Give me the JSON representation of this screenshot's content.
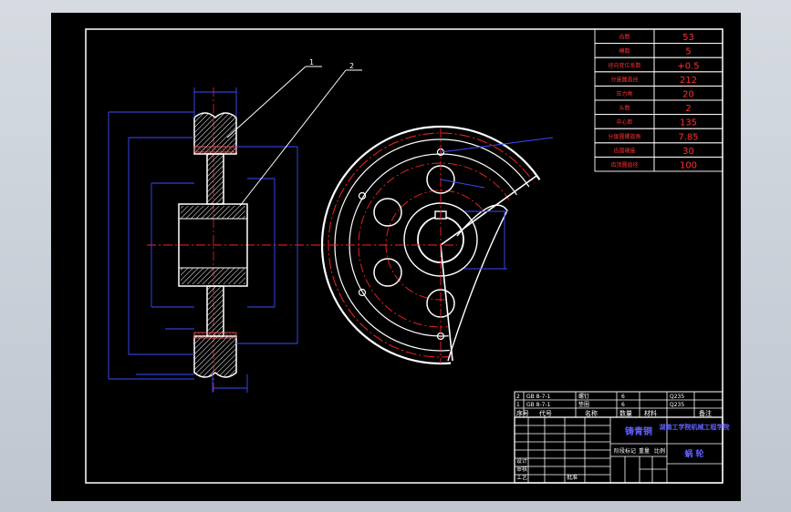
{
  "params_table": {
    "rows": [
      {
        "label": "齿数",
        "value": "53"
      },
      {
        "label": "模数",
        "value": "5"
      },
      {
        "label": "径向变位系数",
        "value": "+0.5"
      },
      {
        "label": "分度圆直径",
        "value": "212"
      },
      {
        "label": "压力角",
        "value": "20"
      },
      {
        "label": "头数",
        "value": "2"
      },
      {
        "label": "中心距",
        "value": "135"
      },
      {
        "label": "分度圆螺旋角",
        "value": "7.85"
      },
      {
        "label": "齿面硬度",
        "value": "30"
      },
      {
        "label": "齿顶圆直径",
        "value": "100"
      }
    ]
  },
  "title_block": {
    "material": "铸青铜",
    "institution": "湖南工学院机械工程学院",
    "drawing_name": "蜗 轮",
    "parts_rows": [
      {
        "no": "2",
        "code": "GB 8-7-1",
        "name": "螺钉",
        "qty": "6",
        "mat": "Q235"
      },
      {
        "no": "1",
        "code": "GB 8-7-1",
        "name": "垫圈",
        "qty": "6",
        "mat": "Q235"
      }
    ],
    "parts_header": [
      "序号",
      "代号",
      "名称",
      "数量",
      "材料",
      "备注"
    ],
    "stage_labels": [
      "阶段标记",
      "重量",
      "比例"
    ],
    "role_labels": [
      "设计",
      "审核",
      "工艺",
      "批准"
    ]
  },
  "leader_labels": [
    "1",
    "2"
  ],
  "colors": {
    "background": "#000000",
    "outline": "#ffffff",
    "dimension": "#3b4cff",
    "centerline": "#ff2020",
    "table_text": "#ff3030"
  }
}
